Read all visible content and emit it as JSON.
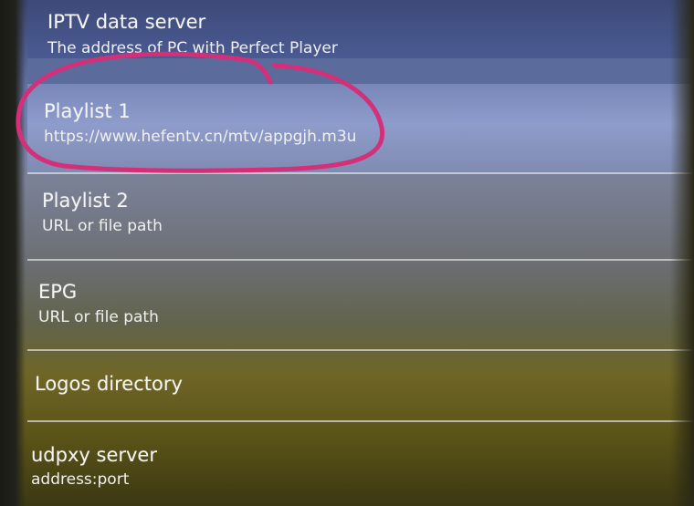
{
  "settings": {
    "items": [
      {
        "title": "IPTV data server",
        "subtitle": "The address of PC with Perfect Player"
      },
      {
        "title": "Playlist 1",
        "subtitle": "https://www.hefentv.cn/mtv/appgjh.m3u"
      },
      {
        "title": "Playlist 2",
        "subtitle": "URL or file path"
      },
      {
        "title": "EPG",
        "subtitle": "URL or file path"
      },
      {
        "title": "Logos directory",
        "subtitle": ""
      },
      {
        "title": "udpxy server",
        "subtitle": "address:port"
      }
    ]
  },
  "annotation": {
    "color": "#d4307a",
    "shape": "hand-drawn-circle"
  }
}
